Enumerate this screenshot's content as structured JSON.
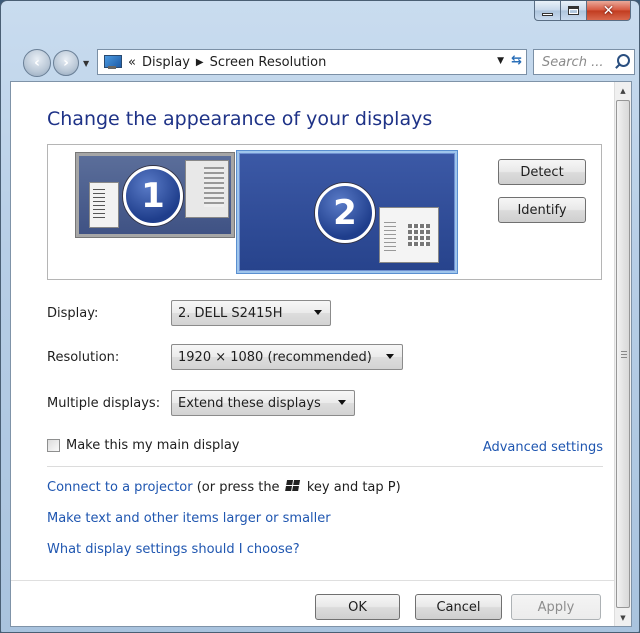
{
  "window": {
    "caption_buttons": [
      "minimize-icon",
      "maximize-icon",
      "close-icon"
    ]
  },
  "nav": {
    "address": {
      "overflow": "«",
      "crumbs": [
        "Display",
        "Screen Resolution"
      ]
    },
    "search_placeholder": "Search ..."
  },
  "page": {
    "heading": "Change the appearance of your displays",
    "monitors": [
      {
        "number": "1",
        "selected": false
      },
      {
        "number": "2",
        "selected": true
      }
    ],
    "detect_button": "Detect",
    "identify_button": "Identify",
    "display": {
      "label": "Display:",
      "value": "2. DELL S2415H"
    },
    "resolution": {
      "label": "Resolution:",
      "value": "1920 × 1080 (recommended)"
    },
    "multiple_displays": {
      "label": "Multiple displays:",
      "value": "Extend these displays"
    },
    "main_display_checkbox": {
      "label": "Make this my main display",
      "checked": false
    },
    "advanced_settings": "Advanced settings",
    "projector_link": "Connect to a projector",
    "projector_hint_pre": "(or press the",
    "projector_hint_post": "key and tap P)",
    "text_size_link": "Make text and other items larger or smaller",
    "help_link": "What display settings should I choose?"
  },
  "footer": {
    "ok": "OK",
    "cancel": "Cancel",
    "apply": "Apply"
  },
  "colors": {
    "link": "#1f56b0",
    "heading": "#1e3287"
  }
}
